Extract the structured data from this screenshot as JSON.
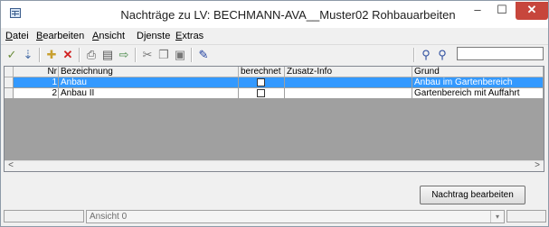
{
  "window": {
    "title": "Nachträge zu LV:  BECHMANN-AVA__Muster02  Rohbauarbeiten",
    "minimize": "–",
    "maximize": "☐",
    "close": "✕"
  },
  "menu": [
    {
      "label": "Datei"
    },
    {
      "label": "Bearbeiten"
    },
    {
      "label": "Ansicht"
    },
    {
      "label": "Djenste"
    },
    {
      "label": "Extras"
    }
  ],
  "toolbar": {
    "icons": [
      "wand-icon",
      "import-icon",
      "new-icon",
      "delete-icon",
      "print-icon",
      "print-preview-icon",
      "export-icon",
      "cut-icon",
      "copy-icon",
      "paste-icon",
      "edit-pen-icon",
      "binoculars-icon",
      "search-next-icon"
    ],
    "search_value": ""
  },
  "grid": {
    "columns": [
      "Nr",
      "Bezeichnung",
      "berechnet",
      "Zusatz-Info",
      "Grund"
    ],
    "rows": [
      {
        "nr": "1",
        "bezeichnung": "Anbau",
        "berechnet": false,
        "zusatz": "",
        "grund": "Anbau im Gartenbereich",
        "selected": true
      },
      {
        "nr": "2",
        "bezeichnung": "Anbau II",
        "berechnet": false,
        "zusatz": "",
        "grund": "Gartenbereich mit Auffahrt",
        "selected": false
      }
    ],
    "scroll_left": "<",
    "scroll_right": ">"
  },
  "actions": {
    "edit_label": "Nachtrag bearbeiten"
  },
  "statusbar": {
    "view_value": "Ansicht 0",
    "view_arrow": "▾"
  },
  "colors": {
    "selection": "#3399ff",
    "close_button": "#c7463c",
    "grid_background": "#a0a0a0"
  }
}
